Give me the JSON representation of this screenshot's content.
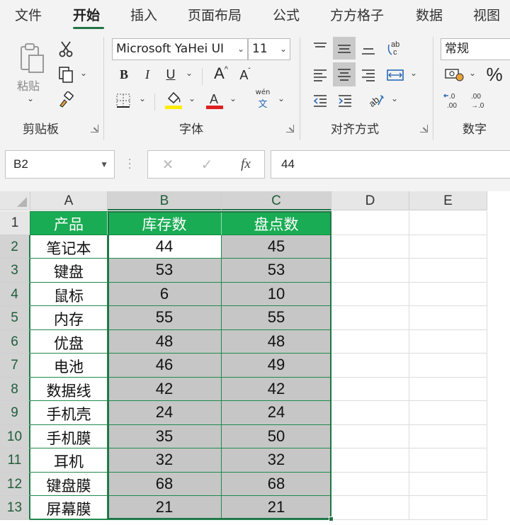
{
  "menu": {
    "tabs": [
      {
        "label": "文件",
        "active": false
      },
      {
        "label": "开始",
        "active": true
      },
      {
        "label": "插入",
        "active": false
      },
      {
        "label": "页面布局",
        "active": false
      },
      {
        "label": "公式",
        "active": false
      },
      {
        "label": "方方格子",
        "active": false
      },
      {
        "label": "数据",
        "active": false
      },
      {
        "label": "视图",
        "active": false
      }
    ]
  },
  "ribbon": {
    "clipboard": {
      "label": "剪贴板",
      "paste_label": "粘贴"
    },
    "font": {
      "label": "字体",
      "font_name": "Microsoft YaHei UI",
      "font_size": "11",
      "bold": "B",
      "italic": "I",
      "underline": "U",
      "grow": "A",
      "shrink": "A",
      "phonetic": "wén",
      "phonetic_char": "文"
    },
    "alignment": {
      "label": "对齐方式"
    },
    "number": {
      "label": "数字",
      "format": "常规",
      "percent": "%"
    }
  },
  "formula_bar": {
    "name_box": "B2",
    "cancel": "✕",
    "confirm": "✓",
    "fx": "fx",
    "value": "44"
  },
  "sheet": {
    "columns": [
      "A",
      "B",
      "C",
      "D",
      "E"
    ],
    "rows": [
      "1",
      "2",
      "3",
      "4",
      "5",
      "6",
      "7",
      "8",
      "9",
      "10",
      "11",
      "12",
      "13"
    ],
    "headers": [
      "产品",
      "库存数",
      "盘点数"
    ],
    "data": [
      [
        "笔记本",
        "44",
        "45"
      ],
      [
        "键盘",
        "53",
        "53"
      ],
      [
        "鼠标",
        "6",
        "10"
      ],
      [
        "内存",
        "55",
        "55"
      ],
      [
        "优盘",
        "48",
        "48"
      ],
      [
        "电池",
        "46",
        "49"
      ],
      [
        "数据线",
        "42",
        "42"
      ],
      [
        "手机壳",
        "24",
        "24"
      ],
      [
        "手机膜",
        "35",
        "50"
      ],
      [
        "耳机",
        "32",
        "32"
      ],
      [
        "键盘膜",
        "68",
        "68"
      ],
      [
        "屏幕膜",
        "21",
        "21"
      ]
    ],
    "active_cell": "B2",
    "colors": {
      "header_fill": "#1aac54",
      "selection": "#217346",
      "selected_fill": "#c6c6c6"
    }
  }
}
